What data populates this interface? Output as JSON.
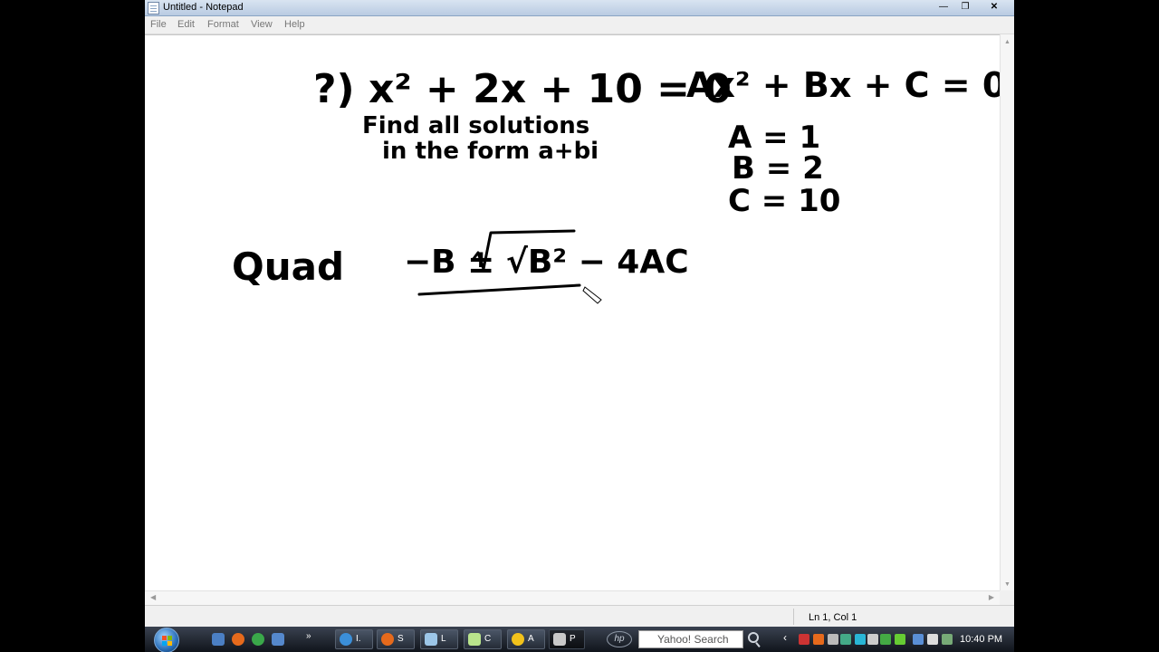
{
  "window": {
    "title": "Untitled - Notepad",
    "controls": {
      "minimize": "—",
      "maximize": "❐",
      "close": "✕"
    }
  },
  "menu": {
    "items": [
      "File",
      "Edit",
      "Format",
      "View",
      "Help"
    ]
  },
  "editor": {
    "lines": [
      "?) x² + 2x + 10 = 0",
      "Find all solutions",
      "in the form a+bi",
      "Ax² + Bx + C = 0",
      "A = 1",
      "B = 2",
      "C = 10",
      "Quad",
      "−B ± √B² − 4AC"
    ],
    "ink_color": "#000000"
  },
  "status": {
    "position": "Ln 1, Col 1"
  },
  "taskbar": {
    "buttons": [
      {
        "icon": "ie-icon",
        "label": "I."
      },
      {
        "icon": "firefox-icon",
        "label": "S"
      },
      {
        "icon": "folder-icon",
        "label": "L"
      },
      {
        "icon": "notepad-icon",
        "label": "C"
      },
      {
        "icon": "yahoo-icon",
        "label": "A"
      },
      {
        "icon": "pen-icon",
        "label": "P"
      }
    ],
    "search_placeholder": "Yahoo! Search",
    "clock": "10:40 PM"
  }
}
